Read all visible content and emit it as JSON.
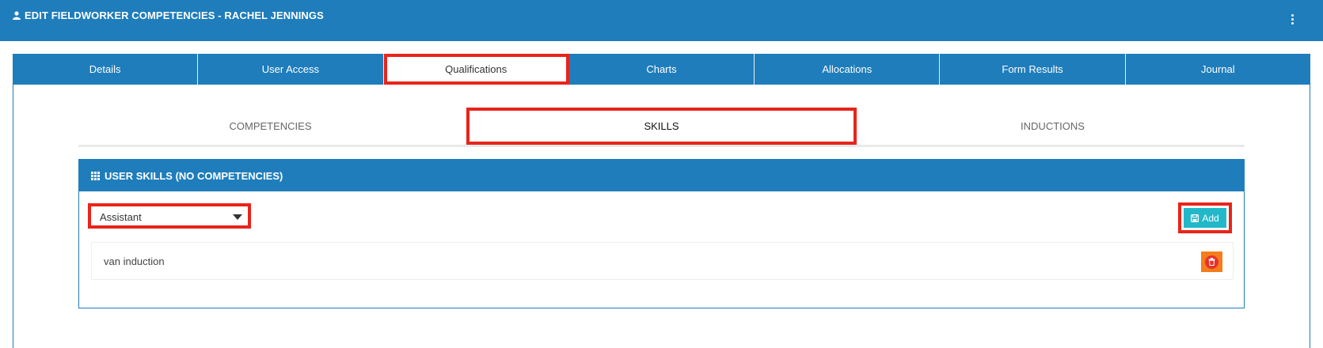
{
  "header": {
    "title": "EDIT FIELDWORKER COMPETENCIES - RACHEL JENNINGS",
    "user_icon": "user-icon",
    "menu_icon": "kebab-menu-icon"
  },
  "tabs": [
    {
      "label": "Details",
      "active": false
    },
    {
      "label": "User Access",
      "active": false
    },
    {
      "label": "Qualifications",
      "active": true
    },
    {
      "label": "Charts",
      "active": false
    },
    {
      "label": "Allocations",
      "active": false
    },
    {
      "label": "Form Results",
      "active": false
    },
    {
      "label": "Journal",
      "active": false
    }
  ],
  "subtabs": [
    {
      "label": "COMPETENCIES",
      "active": false
    },
    {
      "label": "SKILLS",
      "active": true
    },
    {
      "label": "INDUCTIONS",
      "active": false
    }
  ],
  "skills_panel": {
    "title": "USER SKILLS (NO COMPETENCIES)",
    "title_icon": "grid-icon",
    "select_value": "Assistant",
    "add_label": "Add",
    "add_icon": "save-icon",
    "items": [
      {
        "label": "van induction",
        "delete_icon": "trash-icon"
      }
    ]
  },
  "colors": {
    "primary": "#1f7dbb",
    "highlight": "#e8241b",
    "add_button": "#22b8c9",
    "delete_button": "#f47d1c"
  }
}
